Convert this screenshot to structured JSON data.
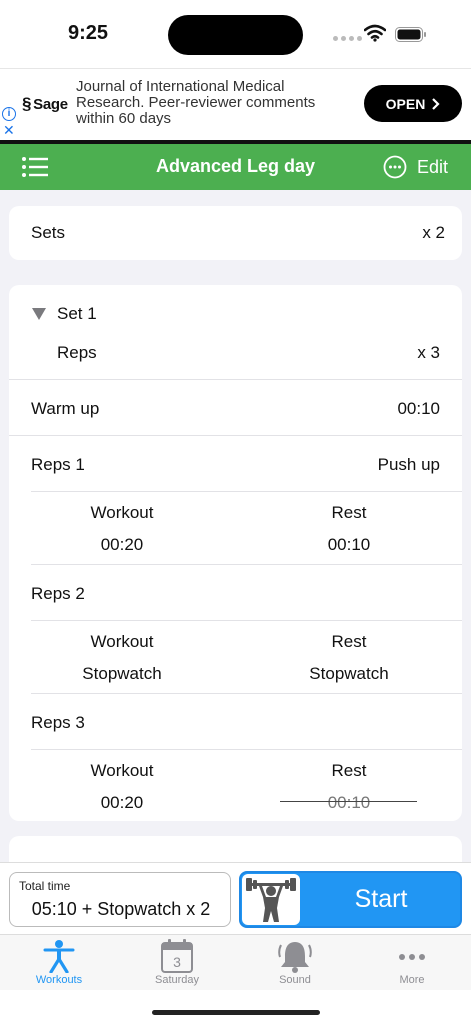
{
  "status_bar": {
    "time": "9:25"
  },
  "ad": {
    "brand": "Sage",
    "text": "Journal of International Medical Research. Peer-reviewer comments within 60 days",
    "open_label": "OPEN"
  },
  "nav": {
    "title": "Advanced Leg day",
    "edit_label": "Edit",
    "accent_color": "#4caf50"
  },
  "sets": {
    "label": "Sets",
    "value": "x 2"
  },
  "set1": {
    "title": "Set 1",
    "reps_label": "Reps",
    "reps_value": "x 3",
    "warmup_label": "Warm up",
    "warmup_value": "00:10",
    "reps": [
      {
        "label": "Reps 1",
        "exercise": "Push up",
        "workout_header": "Workout",
        "rest_header": "Rest",
        "workout": "00:20",
        "rest": "00:10",
        "rest_disabled": false
      },
      {
        "label": "Reps 2",
        "exercise": "",
        "workout_header": "Workout",
        "rest_header": "Rest",
        "workout": "Stopwatch",
        "rest": "Stopwatch",
        "rest_disabled": false
      },
      {
        "label": "Reps 3",
        "exercise": "",
        "workout_header": "Workout",
        "rest_header": "Rest",
        "workout": "00:20",
        "rest": "00:10",
        "rest_disabled": true
      }
    ]
  },
  "footer": {
    "total_label": "Total time",
    "total_value": "05:10 + Stopwatch x 2",
    "start_label": "Start",
    "start_color": "#2196f3"
  },
  "tabs": [
    {
      "label": "Workouts",
      "icon": "person-figure-icon",
      "active": true
    },
    {
      "label": "Saturday",
      "icon": "calendar-icon",
      "badge": "3",
      "active": false
    },
    {
      "label": "Sound",
      "icon": "bell-icon",
      "active": false
    },
    {
      "label": "More",
      "icon": "more-dots-icon",
      "active": false
    }
  ]
}
